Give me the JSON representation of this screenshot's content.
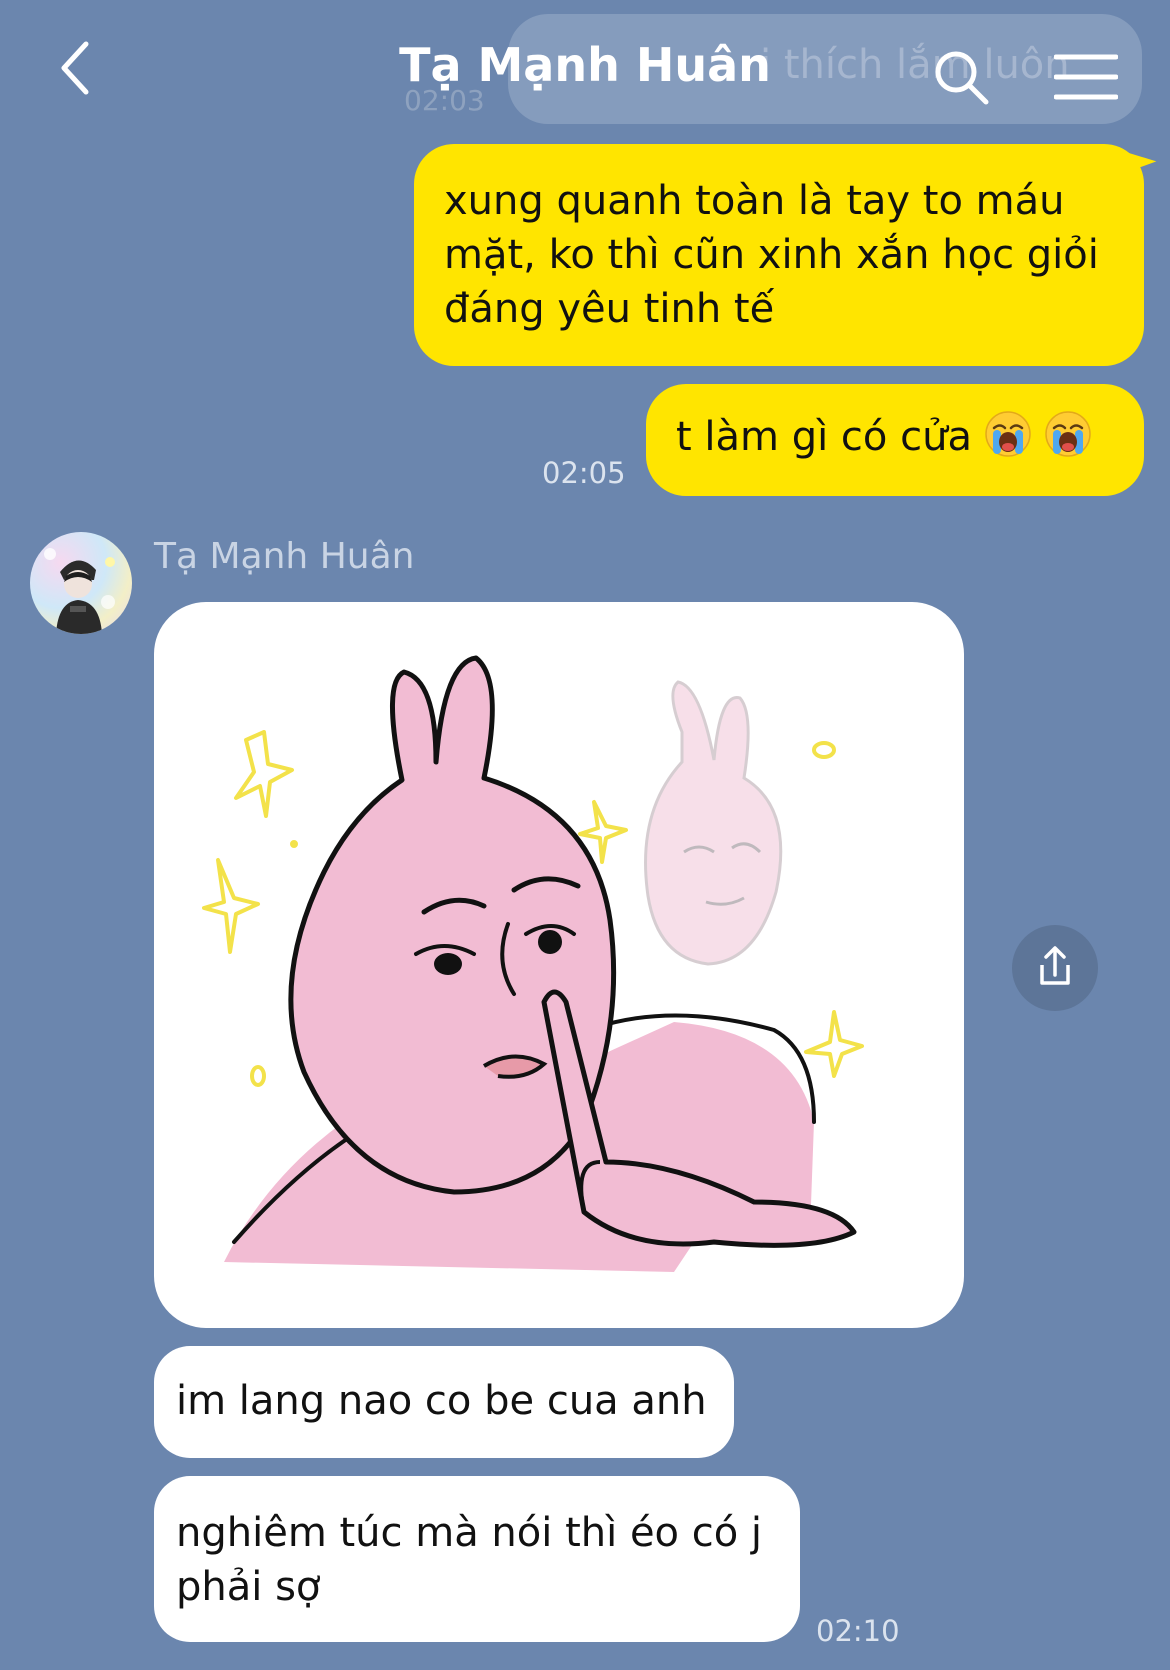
{
  "header": {
    "title": "Tạ Mạnh Huân",
    "back_icon": "chevron-left-icon",
    "search_icon": "search-icon",
    "menu_icon": "hamburger-menu-icon"
  },
  "previous_message": {
    "text": "i thích lắm luôn",
    "time": "02:03"
  },
  "messages_out": [
    {
      "text": "xung quanh toàn là tay to máu mặt, ko thì cũn xinh xắn học giỏi đáng yêu tinh tế"
    },
    {
      "text": "t làm gì có cửa",
      "emojis": [
        "loudly-crying-face-icon",
        "loudly-crying-face-icon"
      ],
      "time": "02:05"
    }
  ],
  "incoming": {
    "sender": "Tạ Mạnh Huân",
    "sticker": "pink-rabbit-thinking-sticker",
    "share_icon": "share-icon",
    "messages": [
      {
        "text": "im lang nao co be cua anh"
      },
      {
        "text": "nghiêm túc mà nói thì éo có j phải sợ",
        "time": "02:10"
      }
    ]
  },
  "colors": {
    "background": "#6b86ae",
    "outgoing_bubble": "#ffe500",
    "incoming_bubble": "#ffffff",
    "sticker_pink": "#f2bcd3"
  }
}
